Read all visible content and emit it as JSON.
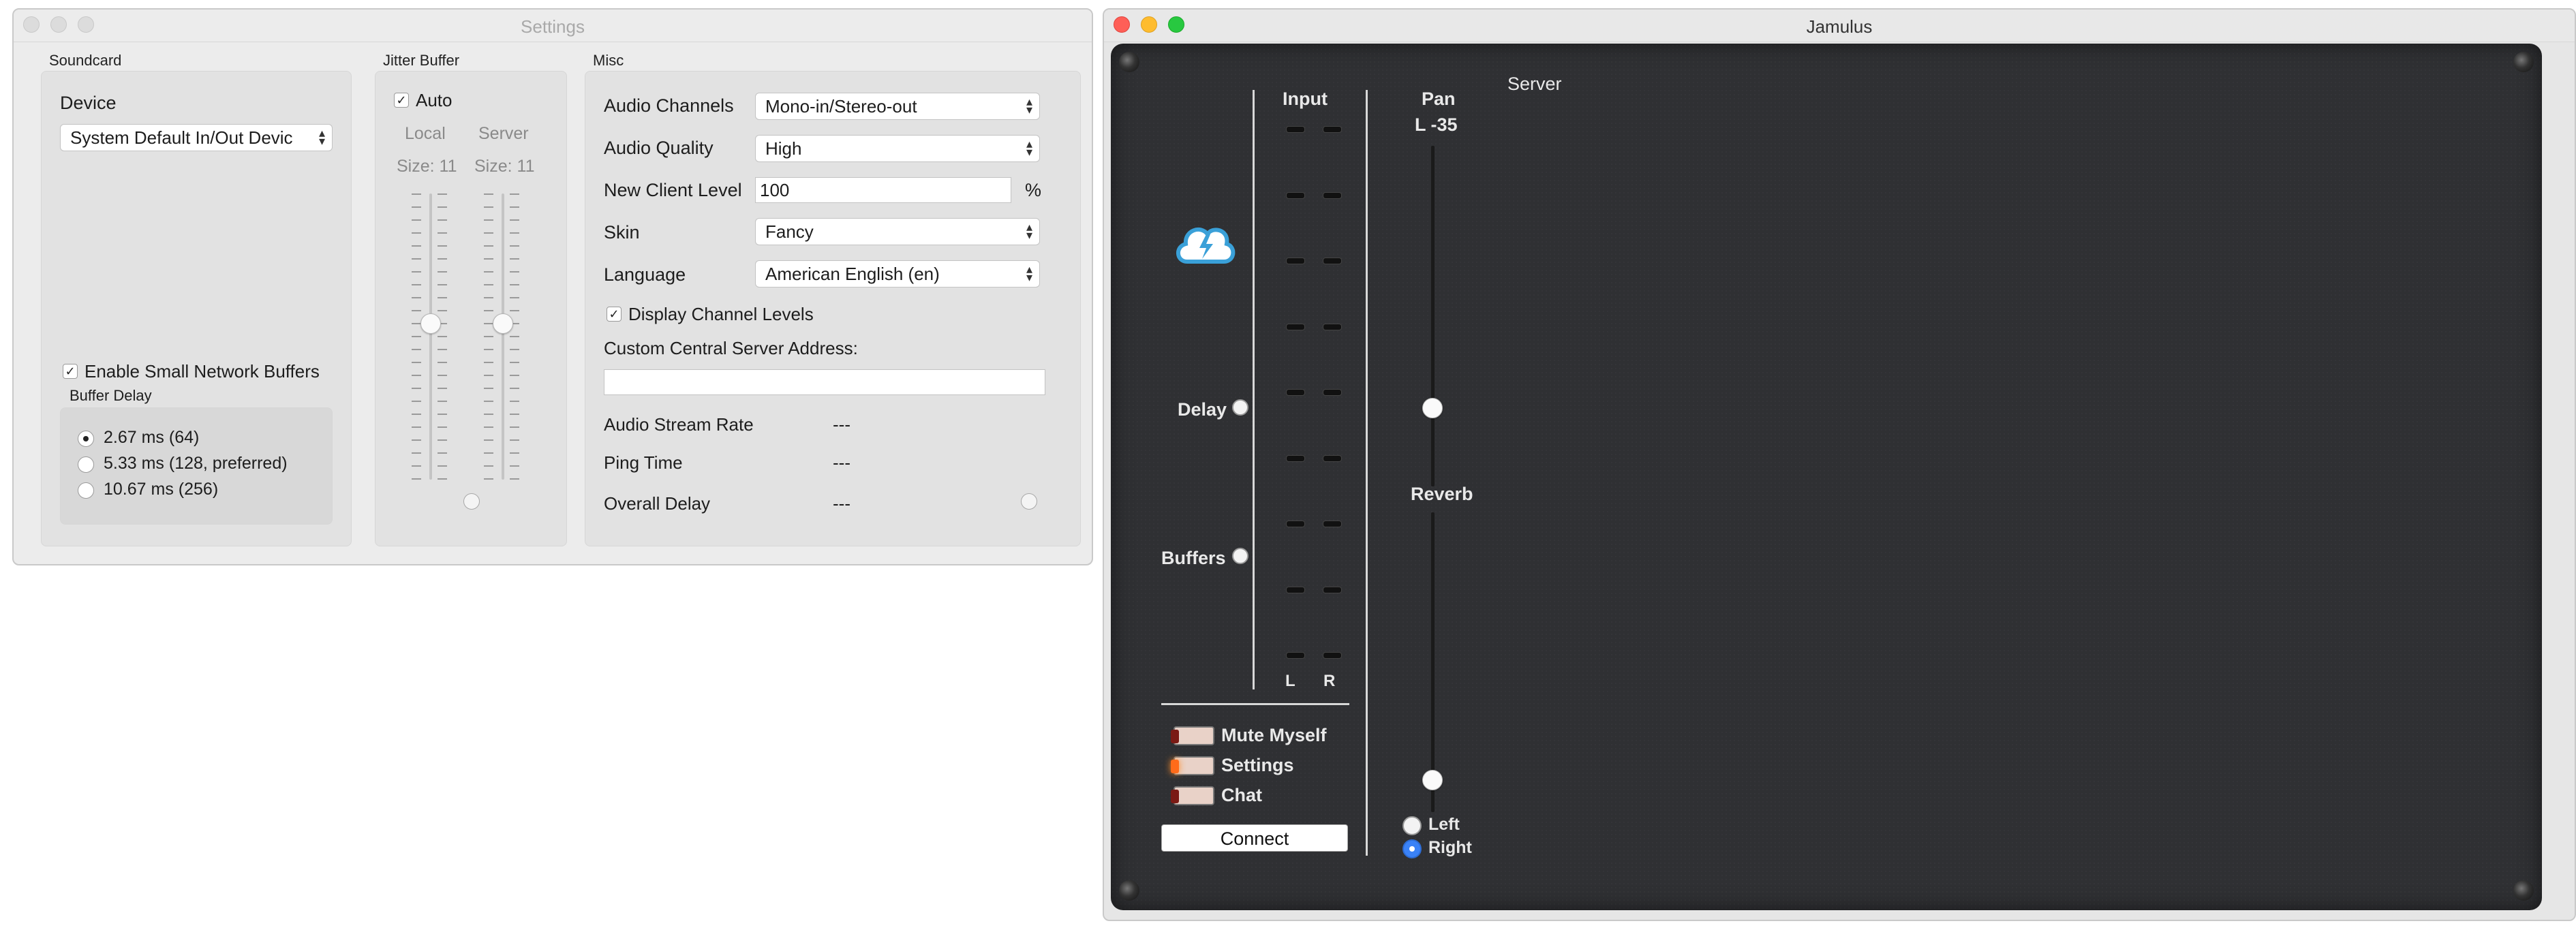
{
  "settings": {
    "title": "Settings",
    "soundcard": {
      "group_label": "Soundcard",
      "device_label": "Device",
      "device_value": "System Default In/Out Devic",
      "small_buffers_label": "Enable Small Network Buffers",
      "small_buffers_checked": true,
      "buffer_delay_label": "Buffer Delay",
      "buffer_options": [
        "2.67 ms (64)",
        "5.33 ms (128, preferred)",
        "10.67 ms (256)"
      ],
      "buffer_selected": 0
    },
    "jitter": {
      "group_label": "Jitter Buffer",
      "auto_label": "Auto",
      "auto_checked": true,
      "local_label": "Local",
      "server_label": "Server",
      "local_size": "Size: 11",
      "server_size": "Size: 11"
    },
    "misc": {
      "group_label": "Misc",
      "audio_channels_label": "Audio Channels",
      "audio_channels_value": "Mono-in/Stereo-out",
      "audio_quality_label": "Audio Quality",
      "audio_quality_value": "High",
      "new_client_level_label": "New Client Level",
      "new_client_level_value": "100",
      "percent_sign": "%",
      "skin_label": "Skin",
      "skin_value": "Fancy",
      "language_label": "Language",
      "language_value": "American English (en)",
      "display_levels_label": "Display Channel Levels",
      "display_levels_checked": true,
      "custom_server_label": "Custom Central Server Address:",
      "custom_server_value": "",
      "stream_rate_label": "Audio Stream Rate",
      "stream_rate_value": "---",
      "ping_label": "Ping Time",
      "ping_value": "---",
      "overall_delay_label": "Overall Delay",
      "overall_delay_value": "---"
    }
  },
  "jamulus": {
    "title": "Jamulus",
    "server_label": "Server",
    "input_label": "Input",
    "pan_label": "Pan",
    "pan_value": "L -35",
    "reverb_label": "Reverb",
    "delay_label": "Delay",
    "buffers_label": "Buffers",
    "meter_left": "L",
    "meter_right": "R",
    "mute_label": "Mute Myself",
    "settings_label": "Settings",
    "chat_label": "Chat",
    "connect_label": "Connect",
    "reverb_left_label": "Left",
    "reverb_right_label": "Right",
    "reverb_channel_selected": "Right",
    "logo_icon": "jamulus-cloud-icon"
  }
}
